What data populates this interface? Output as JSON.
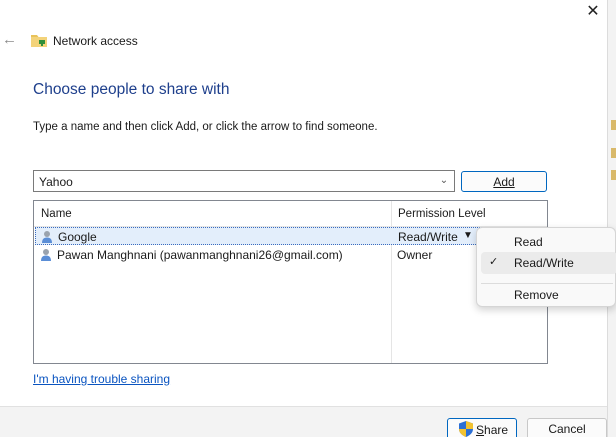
{
  "window": {
    "title": "Network access",
    "close_glyph": "✕",
    "back_glyph": "←"
  },
  "content": {
    "heading": "Choose people to share with",
    "instruction": "Type a name and then click Add, or click the arrow to find someone.",
    "name_input_value": "Yahoo",
    "add_label": "Add"
  },
  "list": {
    "columns": [
      "Name",
      "Permission Level"
    ],
    "rows": [
      {
        "name": "Google",
        "permission": "Read/Write",
        "selected": true
      },
      {
        "name": "Pawan Manghnani (pawanmanghnani26@gmail.com)",
        "permission": "Owner",
        "selected": false
      }
    ]
  },
  "permission_menu": {
    "items": [
      {
        "label": "Read",
        "checked": false
      },
      {
        "label": "Read/Write",
        "checked": true
      },
      {
        "label": "Remove",
        "checked": false
      }
    ],
    "check_glyph": "✓"
  },
  "footer": {
    "trouble_link": "I'm having trouble sharing",
    "share_prefix": "S",
    "share_rest": "hare",
    "cancel_label": "Cancel"
  },
  "colors": {
    "heading": "#1e3f8c",
    "link": "#0a54c0",
    "accent_border": "#0067c0",
    "selection": "#e3eefb"
  },
  "icons": {
    "back": "back-arrow-icon",
    "folder": "network-folder-icon",
    "user": "user-icon",
    "dropdown": "chevron-down-icon",
    "uac": "uac-shield-icon",
    "close": "close-icon"
  }
}
